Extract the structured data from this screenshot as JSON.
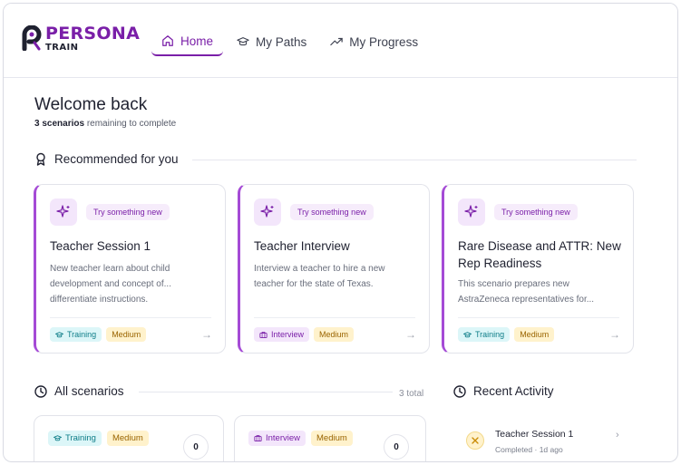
{
  "brand": {
    "title": "PERSONA",
    "subtitle": "TRAIN"
  },
  "nav": [
    {
      "label": "Home",
      "icon": "home-icon",
      "active": true
    },
    {
      "label": "My Paths",
      "icon": "graduation-cap-icon",
      "active": false
    },
    {
      "label": "My Progress",
      "icon": "trending-up-icon",
      "active": false
    }
  ],
  "welcome": {
    "title": "Welcome back",
    "remaining_count": "3 scenarios",
    "remaining_text": "remaining to complete"
  },
  "recommended": {
    "heading": "Recommended for you",
    "cards": [
      {
        "badge": "Try something new",
        "title": "Teacher Session 1",
        "description": "New teacher learn about child development and concept of... differentiate instructions.",
        "type": "Training",
        "difficulty": "Medium"
      },
      {
        "badge": "Try something new",
        "title": "Teacher Interview",
        "description": "Interview a teacher to hire a new teacher for the state of Texas.",
        "type": "Interview",
        "difficulty": "Medium"
      },
      {
        "badge": "Try something new",
        "title": "Rare Disease and ATTR: New Rep Readiness",
        "description": "This scenario prepares new AstraZeneca representatives for...",
        "type": "Training",
        "difficulty": "Medium"
      }
    ]
  },
  "all_scenarios": {
    "heading": "All scenarios",
    "total": "3 total",
    "cards": [
      {
        "type": "Training",
        "difficulty": "Medium",
        "count": "0"
      },
      {
        "type": "Interview",
        "difficulty": "Medium",
        "count": "0"
      }
    ]
  },
  "recent_activity": {
    "heading": "Recent Activity",
    "items": [
      {
        "title": "Teacher Session 1",
        "status": "Completed",
        "time": "1d ago"
      }
    ]
  },
  "colors": {
    "brand": "#7a1fa8",
    "accent_border": "#a54bd6",
    "training_bg": "#dcf6f8",
    "interview_bg": "#f3e6fb",
    "medium_bg": "#fff2cc"
  }
}
